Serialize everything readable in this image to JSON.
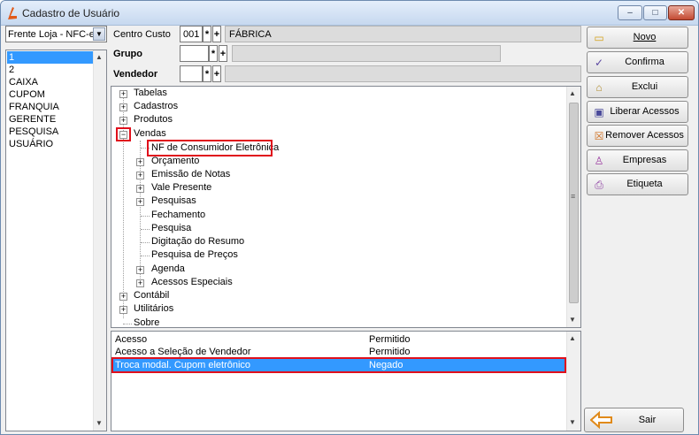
{
  "window": {
    "title": "Cadastro de Usuário",
    "min": "–",
    "max": "□",
    "close": "✕"
  },
  "loja": {
    "value": "Frente Loja - NFC-e",
    "arrow": "▼"
  },
  "users": [
    "1",
    "2",
    "CAIXA",
    "CUPOM",
    "FRANQUIA",
    "GERENTE",
    "PESQUISA",
    "USUÁRIO"
  ],
  "selected_user": "1",
  "fields": {
    "centro_custo": {
      "label": "Centro Custo",
      "code": "001",
      "name": "FÁBRICA"
    },
    "grupo": {
      "label": "Grupo",
      "code": "",
      "name": ""
    },
    "vendedor": {
      "label": "Vendedor",
      "code": "",
      "name": ""
    },
    "star": "*",
    "plus": "+"
  },
  "tree": {
    "top": [
      "Tabelas",
      "Cadastros",
      "Produtos",
      "Vendas"
    ],
    "vendas_children": [
      "NF de Consumidor Eletrônica",
      "Orçamento",
      "Emissão de Notas",
      "Vale Presente",
      "Pesquisas",
      "Fechamento",
      "Pesquisa",
      "Digitação do Resumo",
      "Pesquisa de Preços",
      "Agenda",
      "Acessos Especiais"
    ],
    "bottom": [
      "Contábil",
      "Utilitários",
      "Sobre"
    ],
    "expand": "+",
    "collapse": "−"
  },
  "permissions": [
    {
      "access": "Acesso",
      "status": "Permitido"
    },
    {
      "access": "Acesso a Seleção de Vendedor",
      "status": "Permitido"
    },
    {
      "access": "Troca modal. Cupom eletrônico",
      "status": "Negado"
    }
  ],
  "actions": {
    "novo": "Novo",
    "confirma": "Confirma",
    "exclui": "Exclui",
    "liberar": "Liberar Acessos",
    "remover": "Remover Acessos",
    "empresas": "Empresas",
    "etiqueta": "Etiqueta",
    "sair": "Sair"
  },
  "scroll": {
    "up": "▲",
    "down": "▼",
    "grip": "≡"
  },
  "colors": {
    "selection": "#3399ff",
    "highlight_border": "#e0101c"
  }
}
